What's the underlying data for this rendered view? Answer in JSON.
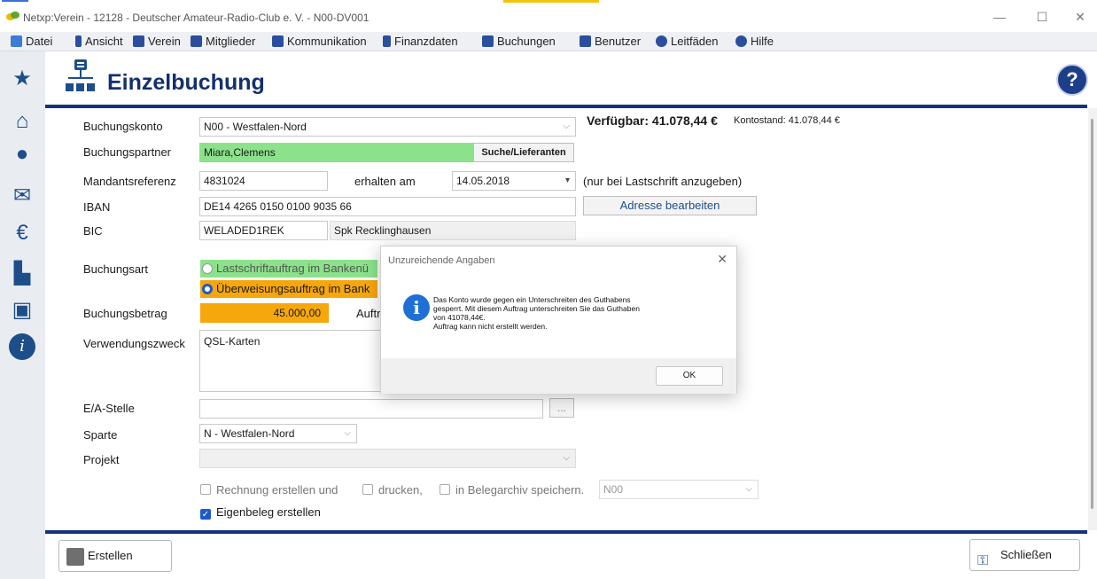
{
  "window": {
    "title": "Netxp:Verein - 12128 - Deutscher Amateur-Radio-Club e. V. - N00-DV001",
    "min": "—",
    "max": "☐",
    "close": "✕"
  },
  "menu": [
    "Datei",
    "Ansicht",
    "Verein",
    "Mitglieder",
    "Kommunikation",
    "Finanzdaten",
    "Buchungen",
    "Benutzer",
    "Leitfäden",
    "Hilfe"
  ],
  "page": {
    "title": "Einzelbuchung",
    "help": "?"
  },
  "form": {
    "buchungskonto_label": "Buchungskonto",
    "buchungskonto_value": "N00 - Westfalen-Nord",
    "verfuegbar": "Verfügbar: 41.078,44 €",
    "kontostand": "Kontostand: 41.078,44 €",
    "partner_label": "Buchungspartner",
    "partner_value": "Miara,Clemens",
    "partner_search": "Suche/Lieferanten",
    "mandat_label": "Mandantsreferenz",
    "mandat_value": "4831024",
    "erhalten_label": "erhalten am",
    "erhalten_value": "14.05.2018",
    "lastschrift_note": "(nur bei Lastschrift anzugeben)",
    "iban_label": "IBAN",
    "iban_value": "DE14 4265 0150 0100 9035 66",
    "adresse_btn": "Adresse bearbeiten",
    "bic_label": "BIC",
    "bic_value": "WELADED1REK",
    "bank_value": "Spk Recklinghausen",
    "art_label": "Buchungsart",
    "art_option1": "Lastschriftauftrag im Bankenü",
    "art_option2": "Überweisungsauftrag im Bank",
    "betrag_label": "Buchungsbetrag",
    "betrag_value": "45.000,00",
    "auftr_label": "Auftr",
    "zweck_label": "Verwendungszweck",
    "zweck_value": "QSL-Karten",
    "ea_label": "E/A-Stelle",
    "ea_btn": "...",
    "sparte_label": "Sparte",
    "sparte_value": "N - Westfalen-Nord",
    "projekt_label": "Projekt",
    "rechnung_label": "Rechnung erstellen und",
    "drucken_label": "drucken,",
    "belegarchiv_label": "in Belegarchiv speichern.",
    "belegarchiv_value": "N00",
    "eigenbeleg_label": "Eigenbeleg erstellen"
  },
  "footer": {
    "create": "Erstellen",
    "close": "Schließen"
  },
  "dialog": {
    "title": "Unzureichende Angaben",
    "message_line1": "Das Konto wurde gegen ein Unterschreiten des Guthabens",
    "message_line2": "gesperrt. Mit diesem Auftrag unterschreiten Sie das Guthaben",
    "message_line3": "von 41078,44€.",
    "message_line4": "Auftrag kann nicht erstellt werden.",
    "ok": "OK"
  },
  "colors": {
    "accent": "#15337a",
    "green": "#8be28b",
    "orange": "#f6a70c",
    "info": "#1e6fd6"
  }
}
